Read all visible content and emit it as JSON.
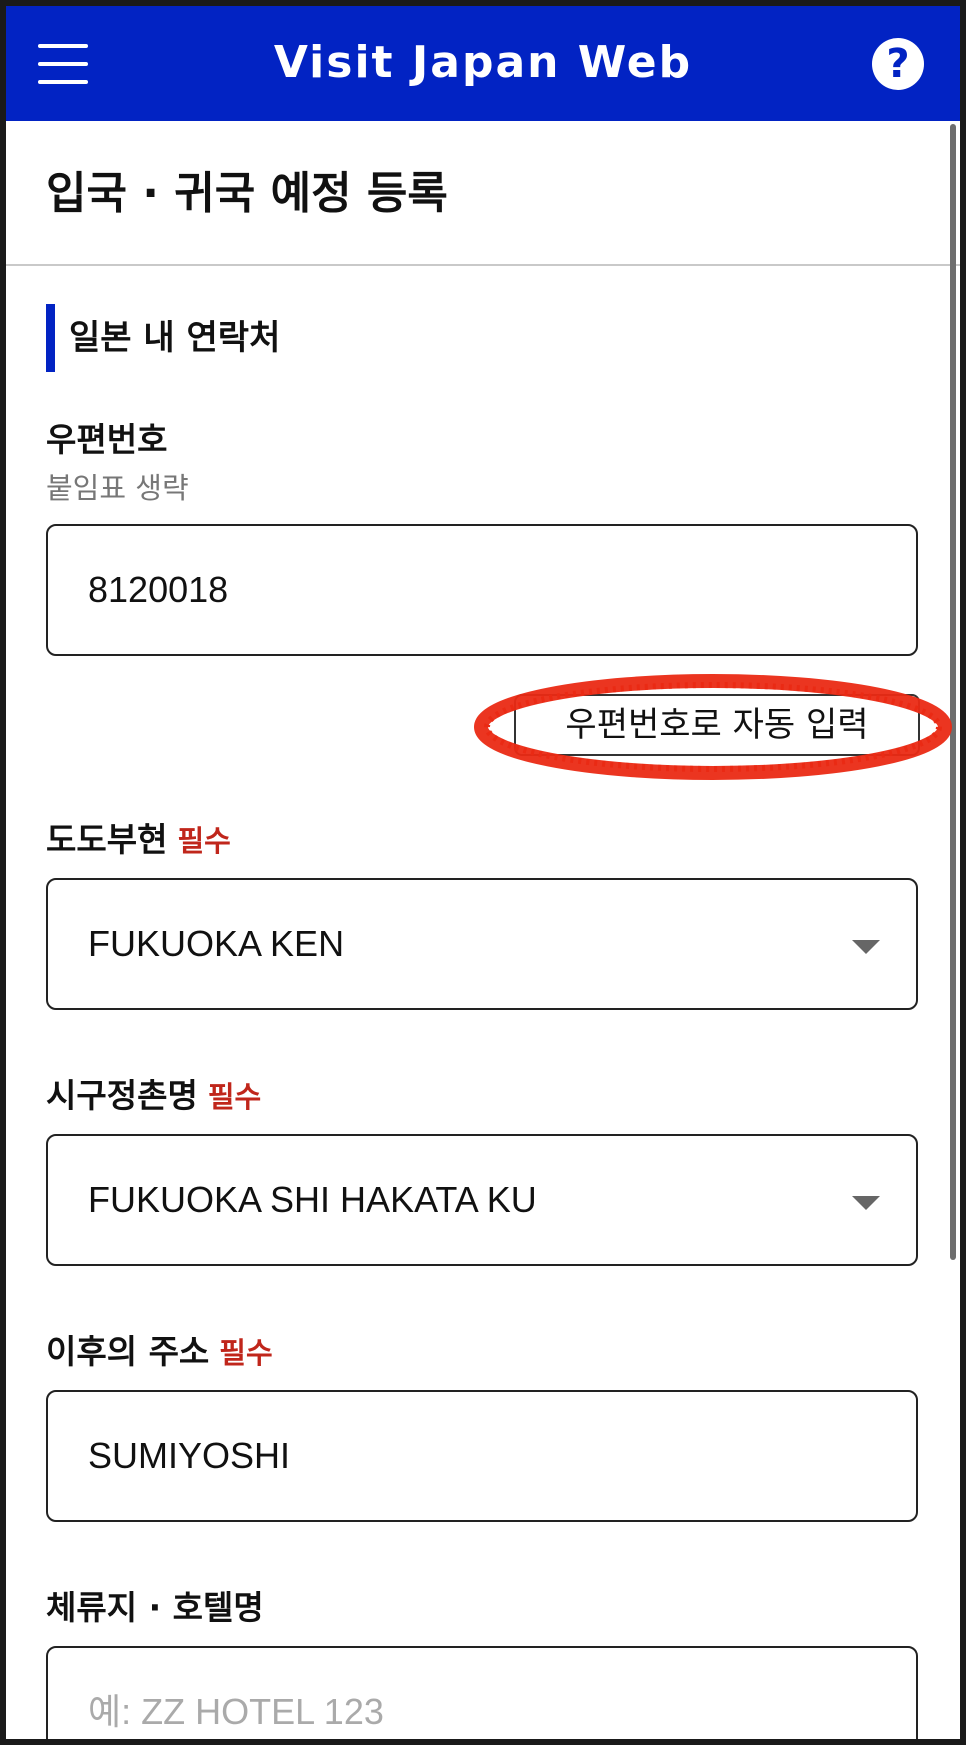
{
  "header": {
    "app_title": "Visit Japan Web",
    "help_symbol": "?",
    "background_color": "#0223c3"
  },
  "page": {
    "title": "입국 · 귀국 예정 등록"
  },
  "section": {
    "title": "일본 내 연락처"
  },
  "postal": {
    "label": "우편번호",
    "hint": "붙임표 생략",
    "value": "8120018",
    "autofill_label": "우편번호로 자동 입력"
  },
  "prefecture": {
    "label": "도도부현",
    "required": "필수",
    "value": "FUKUOKA KEN"
  },
  "city": {
    "label": "시구정촌명",
    "required": "필수",
    "value": "FUKUOKA SHI HAKATA KU"
  },
  "address": {
    "label": "이후의 주소",
    "required": "필수",
    "value": "SUMIYOSHI"
  },
  "hotel": {
    "label": "체류지 · 호텔명",
    "placeholder": "예: ZZ HOTEL 123"
  },
  "colors": {
    "required": "#c0261b",
    "annotation": "#ea2a14"
  }
}
